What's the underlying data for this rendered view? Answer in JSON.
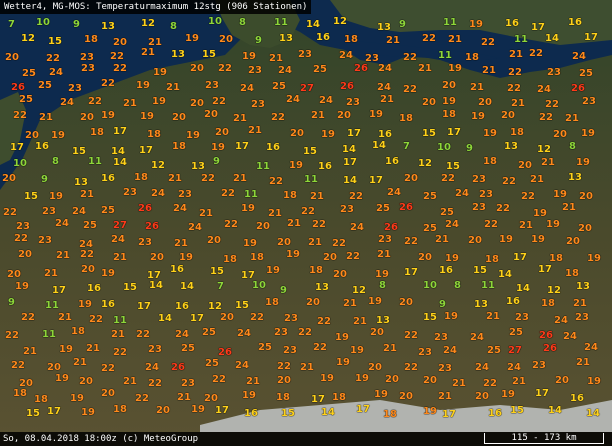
{
  "title": "Wetter4, MG-MOS: Temperaturmaximum 12stg (906 Stationen)",
  "footer": "So, 08.04.2018 18:00z (c) MeteoGroup",
  "scale_label": "115 - 173 km",
  "colors": {
    "sea": "#0d2a4e",
    "land_north": "#3a4a28",
    "land_south": "#56502f",
    "alps": "#cfd4da",
    "t_low": "#8ed63a",
    "t_mid": "#ffd21a",
    "t_high": "#ff8a1c",
    "t_max": "#ff3b1a"
  },
  "stations": [
    {
      "t": 7
    },
    {
      "t": 10
    },
    {
      "t": 9
    },
    {
      "t": 13
    },
    {
      "t": 12
    },
    {
      "t": 8
    },
    {
      "t": 10
    },
    {
      "t": 8
    },
    {
      "t": 11
    },
    {
      "t": 14
    },
    {
      "t": 12
    },
    {
      "t": 13
    },
    {
      "t": 9
    },
    {
      "t": 11
    },
    {
      "t": 19
    },
    {
      "t": 16
    },
    {
      "t": 17
    },
    {
      "t": 16
    },
    {
      "t": 12
    },
    {
      "t": 15
    },
    {
      "t": 18
    },
    {
      "t": 20
    },
    {
      "t": 21
    },
    {
      "t": 19
    },
    {
      "t": 20
    },
    {
      "t": 9
    },
    {
      "t": 13
    },
    {
      "t": 16
    },
    {
      "t": 18
    },
    {
      "t": 21
    },
    {
      "t": 22
    },
    {
      "t": 21
    },
    {
      "t": 22
    },
    {
      "t": 11
    },
    {
      "t": 14
    },
    {
      "t": 17
    },
    {
      "t": 20
    },
    {
      "t": 22
    },
    {
      "t": 23
    },
    {
      "t": 22
    },
    {
      "t": 21
    },
    {
      "t": 13
    },
    {
      "t": 15
    },
    {
      "t": 19
    },
    {
      "t": 21
    },
    {
      "t": 23
    },
    {
      "t": 24
    },
    {
      "t": 23
    },
    {
      "t": 22
    },
    {
      "t": 11
    },
    {
      "t": 18
    },
    {
      "t": 21
    },
    {
      "t": 22
    },
    {
      "t": 24
    },
    {
      "t": 25
    },
    {
      "t": 24
    },
    {
      "t": 23
    },
    {
      "t": 22
    },
    {
      "t": 19
    },
    {
      "t": 20
    },
    {
      "t": 22
    },
    {
      "t": 23
    },
    {
      "t": 24
    },
    {
      "t": 25
    },
    {
      "t": 26
    },
    {
      "t": 24
    },
    {
      "t": 21
    },
    {
      "t": 19
    },
    {
      "t": 21
    },
    {
      "t": 22
    },
    {
      "t": 23
    },
    {
      "t": 25
    },
    {
      "t": 26
    },
    {
      "t": 25
    },
    {
      "t": 23
    },
    {
      "t": 22
    },
    {
      "t": 19
    },
    {
      "t": 21
    },
    {
      "t": 23
    },
    {
      "t": 24
    },
    {
      "t": 25
    },
    {
      "t": 27
    },
    {
      "t": 26
    },
    {
      "t": 24
    },
    {
      "t": 22
    },
    {
      "t": 20
    },
    {
      "t": 21
    },
    {
      "t": 22
    },
    {
      "t": 24
    },
    {
      "t": 26
    },
    {
      "t": 25
    },
    {
      "t": 24
    },
    {
      "t": 22
    },
    {
      "t": 21
    },
    {
      "t": 19
    },
    {
      "t": 20
    },
    {
      "t": 22
    },
    {
      "t": 23
    },
    {
      "t": 24
    },
    {
      "t": 24
    },
    {
      "t": 23
    },
    {
      "t": 21
    },
    {
      "t": 20
    },
    {
      "t": 19
    },
    {
      "t": 20
    },
    {
      "t": 21
    },
    {
      "t": 22
    },
    {
      "t": 23
    },
    {
      "t": 22
    },
    {
      "t": 21
    },
    {
      "t": 20
    },
    {
      "t": 19
    },
    {
      "t": 19
    },
    {
      "t": 20
    },
    {
      "t": 20
    },
    {
      "t": 21
    },
    {
      "t": 22
    },
    {
      "t": 21
    },
    {
      "t": 20
    },
    {
      "t": 19
    },
    {
      "t": 18
    },
    {
      "t": 18
    },
    {
      "t": 19
    },
    {
      "t": 20
    },
    {
      "t": 22
    },
    {
      "t": 21
    },
    {
      "t": 20
    },
    {
      "t": 19
    },
    {
      "t": 18
    },
    {
      "t": 17
    },
    {
      "t": 18
    },
    {
      "t": 19
    },
    {
      "t": 20
    },
    {
      "t": 21
    },
    {
      "t": 20
    },
    {
      "t": 19
    },
    {
      "t": 17
    },
    {
      "t": 16
    },
    {
      "t": 15
    },
    {
      "t": 17
    },
    {
      "t": 19
    },
    {
      "t": 18
    },
    {
      "t": 20
    },
    {
      "t": 19
    },
    {
      "t": 17
    },
    {
      "t": 16
    },
    {
      "t": 15
    },
    {
      "t": 14
    },
    {
      "t": 17
    },
    {
      "t": 18
    },
    {
      "t": 19
    },
    {
      "t": 17
    },
    {
      "t": 16
    },
    {
      "t": 15
    },
    {
      "t": 14
    },
    {
      "t": 14
    }
  ]
}
